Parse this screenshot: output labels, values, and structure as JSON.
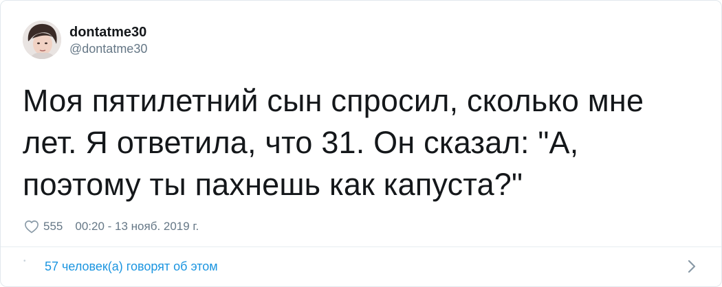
{
  "author": {
    "display_name": "dontatme30",
    "handle": "@dontatme30",
    "avatar_icon": "avatar-photo"
  },
  "tweet": {
    "text": "Моя пятилетний сын спросил, сколько мне лет. Я ответила, что 31. Он сказал: \"А, поэтому ты пахнешь как капуста?\""
  },
  "meta": {
    "like_icon": "heart-outline-icon",
    "likes": "555",
    "timestamp": "00:20 - 13 нояб. 2019 г."
  },
  "footer": {
    "conversation_text": "57 человек(а) говорят об этом",
    "chevron_icon": "chevron-right-icon"
  },
  "colors": {
    "text": "#14171a",
    "secondary": "#657786",
    "link": "#1b95e0",
    "border": "#e1e8ed"
  }
}
